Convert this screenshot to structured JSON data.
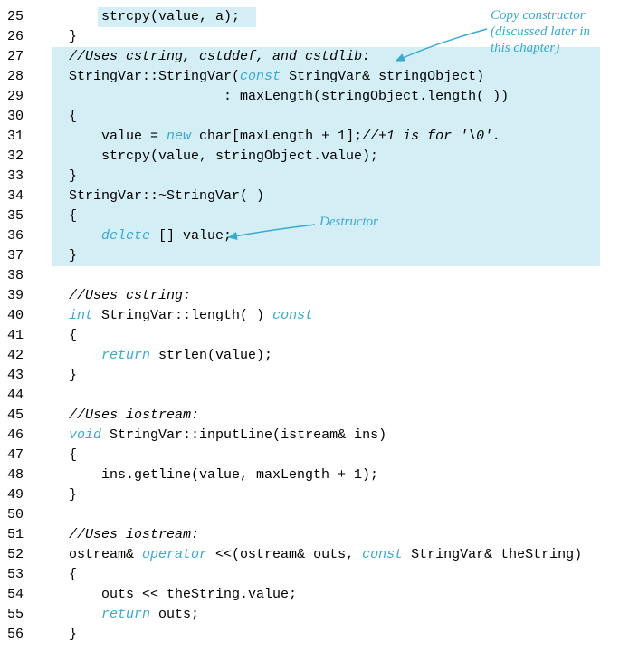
{
  "lines": [
    {
      "num": "25",
      "tokens": [
        {
          "t": "        strcpy(value, a);"
        }
      ]
    },
    {
      "num": "26",
      "tokens": [
        {
          "t": "    }"
        }
      ]
    },
    {
      "num": "27",
      "tokens": [
        {
          "t": "    ",
          "c": ""
        },
        {
          "t": "//Uses cstring, cstddef, and cstdlib:",
          "c": "comment"
        }
      ]
    },
    {
      "num": "28",
      "tokens": [
        {
          "t": "    StringVar::StringVar("
        },
        {
          "t": "const",
          "c": "keyword"
        },
        {
          "t": " StringVar& stringObject)"
        }
      ]
    },
    {
      "num": "29",
      "tokens": [
        {
          "t": "                       : maxLength(stringObject.length( ))"
        }
      ]
    },
    {
      "num": "30",
      "tokens": [
        {
          "t": "    {"
        }
      ]
    },
    {
      "num": "31",
      "tokens": [
        {
          "t": "        value = "
        },
        {
          "t": "new",
          "c": "keyword"
        },
        {
          "t": " char[maxLength + 1];"
        },
        {
          "t": "//+1 is for '\\0'.",
          "c": "comment"
        }
      ]
    },
    {
      "num": "32",
      "tokens": [
        {
          "t": "        strcpy(value, stringObject.value);"
        }
      ]
    },
    {
      "num": "33",
      "tokens": [
        {
          "t": "    }"
        }
      ]
    },
    {
      "num": "34",
      "tokens": [
        {
          "t": "    StringVar::~StringVar( )"
        }
      ]
    },
    {
      "num": "35",
      "tokens": [
        {
          "t": "    {"
        }
      ]
    },
    {
      "num": "36",
      "tokens": [
        {
          "t": "        "
        },
        {
          "t": "delete",
          "c": "keyword"
        },
        {
          "t": " [] value;"
        }
      ]
    },
    {
      "num": "37",
      "tokens": [
        {
          "t": "    }"
        }
      ]
    },
    {
      "num": "38",
      "tokens": [
        {
          "t": ""
        }
      ]
    },
    {
      "num": "39",
      "tokens": [
        {
          "t": "    ",
          "c": ""
        },
        {
          "t": "//Uses cstring:",
          "c": "comment"
        }
      ]
    },
    {
      "num": "40",
      "tokens": [
        {
          "t": "    "
        },
        {
          "t": "int",
          "c": "keyword"
        },
        {
          "t": " StringVar::length( ) "
        },
        {
          "t": "const",
          "c": "keyword"
        }
      ]
    },
    {
      "num": "41",
      "tokens": [
        {
          "t": "    {"
        }
      ]
    },
    {
      "num": "42",
      "tokens": [
        {
          "t": "        "
        },
        {
          "t": "return",
          "c": "keyword"
        },
        {
          "t": " strlen(value);"
        }
      ]
    },
    {
      "num": "43",
      "tokens": [
        {
          "t": "    }"
        }
      ]
    },
    {
      "num": "44",
      "tokens": [
        {
          "t": ""
        }
      ]
    },
    {
      "num": "45",
      "tokens": [
        {
          "t": "    ",
          "c": ""
        },
        {
          "t": "//Uses iostream:",
          "c": "comment"
        }
      ]
    },
    {
      "num": "46",
      "tokens": [
        {
          "t": "    "
        },
        {
          "t": "void",
          "c": "keyword"
        },
        {
          "t": " StringVar::inputLine(istream& ins)"
        }
      ]
    },
    {
      "num": "47",
      "tokens": [
        {
          "t": "    {"
        }
      ]
    },
    {
      "num": "48",
      "tokens": [
        {
          "t": "        ins.getline(value, maxLength + 1);"
        }
      ]
    },
    {
      "num": "49",
      "tokens": [
        {
          "t": "    }"
        }
      ]
    },
    {
      "num": "50",
      "tokens": [
        {
          "t": ""
        }
      ]
    },
    {
      "num": "51",
      "tokens": [
        {
          "t": "    ",
          "c": ""
        },
        {
          "t": "//Uses iostream:",
          "c": "comment"
        }
      ]
    },
    {
      "num": "52",
      "tokens": [
        {
          "t": "    ostream& "
        },
        {
          "t": "operator",
          "c": "keyword"
        },
        {
          "t": " <<(ostream& outs, "
        },
        {
          "t": "const",
          "c": "keyword"
        },
        {
          "t": " StringVar& theString)"
        }
      ]
    },
    {
      "num": "53",
      "tokens": [
        {
          "t": "    {"
        }
      ]
    },
    {
      "num": "54",
      "tokens": [
        {
          "t": "        outs << theString.value;"
        }
      ]
    },
    {
      "num": "55",
      "tokens": [
        {
          "t": "        "
        },
        {
          "t": "return",
          "c": "keyword"
        },
        {
          "t": " outs;"
        }
      ]
    },
    {
      "num": "56",
      "tokens": [
        {
          "t": "    }"
        }
      ]
    }
  ],
  "annotations": {
    "copy_constructor": "Copy constructor\n(discussed later in\nthis chapter)",
    "destructor": "Destructor"
  }
}
